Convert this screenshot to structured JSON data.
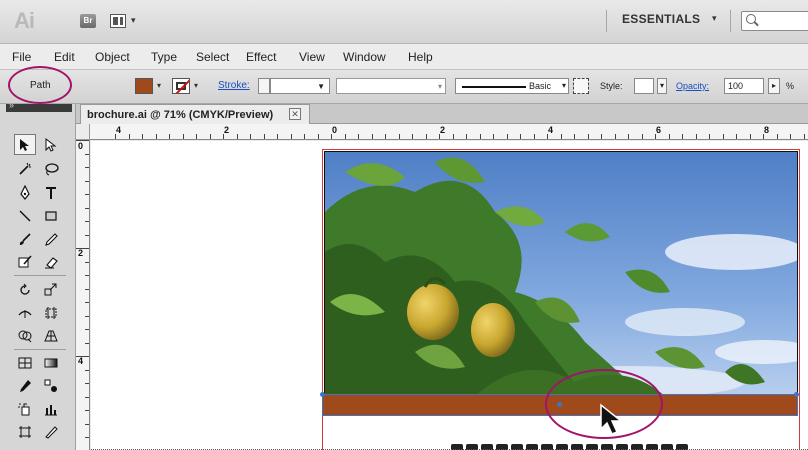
{
  "app": {
    "logo": "Ai",
    "bridge_label": "Br",
    "workspace_label": "ESSENTIALS"
  },
  "menu": [
    "File",
    "Edit",
    "Object",
    "Type",
    "Select",
    "Effect",
    "View",
    "Window",
    "Help"
  ],
  "control_bar": {
    "selection_type": "Path",
    "fill_color": "#a04a1c",
    "stroke_label": "Stroke:",
    "brush_label": "Basic",
    "style_label": "Style:",
    "opacity_label": "Opacity:",
    "opacity_value": "100",
    "opacity_unit": "%"
  },
  "document": {
    "tab_title": "brochure.ai @ 71% (CMYK/Preview)",
    "close_symbol": "✕"
  },
  "rulers": {
    "horizontal": [
      "4",
      "2",
      "0",
      "2",
      "4",
      "6",
      "8"
    ],
    "vertical": [
      "0",
      "2",
      "4"
    ]
  },
  "colors": {
    "accent_highlight": "#a4136a",
    "brown_bar": "#a04a1c",
    "selection": "#3d74c8",
    "artboard_border": "#d43a3a"
  },
  "icons": {
    "selection_tool": "selection-arrow-icon",
    "direct_selection": "direct-selection-icon",
    "magic_wand": "magic-wand-icon",
    "lasso": "lasso-icon",
    "pen": "pen-icon",
    "type": "type-icon",
    "line": "line-segment-icon",
    "rectangle": "rectangle-icon",
    "paintbrush": "paintbrush-icon",
    "pencil": "pencil-icon",
    "blob_brush": "blob-brush-icon",
    "eraser": "eraser-icon",
    "rotate": "rotate-icon",
    "scale": "scale-icon",
    "width": "width-tool-icon",
    "free_transform": "free-transform-icon",
    "shape_builder": "shape-builder-icon",
    "perspective": "perspective-grid-icon",
    "mesh": "mesh-icon",
    "gradient": "gradient-icon",
    "eyedropper": "eyedropper-icon",
    "blend": "blend-icon",
    "symbol_sprayer": "symbol-sprayer-icon",
    "column_graph": "column-graph-icon",
    "artboard": "artboard-icon",
    "slice": "slice-icon"
  }
}
